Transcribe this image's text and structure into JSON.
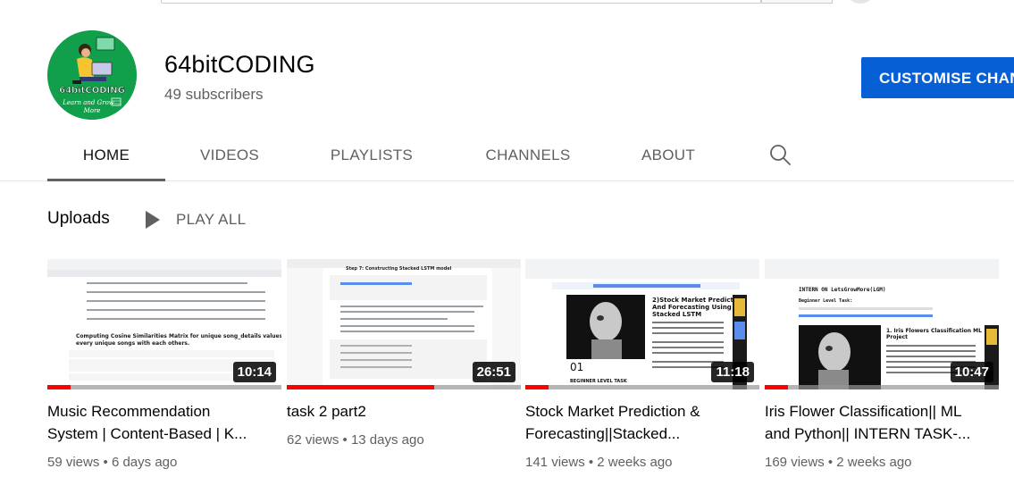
{
  "channel": {
    "name": "64bitCODING",
    "subscribers": "49 subscribers",
    "customise_label": "CUSTOMISE CHANNEL",
    "avatar_text": "64bitCODING",
    "avatar_subtext": "Learn and Grow More",
    "avatar_color": "#119f4b"
  },
  "tabs": [
    {
      "label": "HOME",
      "active": true
    },
    {
      "label": "VIDEOS"
    },
    {
      "label": "PLAYLISTS"
    },
    {
      "label": "CHANNELS"
    },
    {
      "label": "ABOUT"
    }
  ],
  "tab_search_icon": "search-icon",
  "section": {
    "title": "Uploads",
    "play_all": "PLAY ALL"
  },
  "videos": [
    {
      "title_line1": "Music Recommendation",
      "title_line2": "System | Content-Based | K...",
      "views": "59 views",
      "age": "6 days ago",
      "duration": "10:14",
      "watched_fraction": 0.1,
      "thumb_heading": "Computing Cosine Similarities Matrix for unique song_details values / for every unique songs with each others."
    },
    {
      "title_line1": "task 2 part2",
      "title_line2": "",
      "views": "62 views",
      "age": "13 days ago",
      "duration": "26:51",
      "watched_fraction": 0.63,
      "thumb_heading": "Step 7: Constructing Stacked LSTM model"
    },
    {
      "title_line1": "Stock Market Prediction &",
      "title_line2": "Forecasting||Stacked...",
      "views": "141 views",
      "age": "2 weeks ago",
      "duration": "11:18",
      "watched_fraction": 0.1,
      "thumb_heading": "2)Stock Market Prediction And Forecasting Using Stacked LSTM",
      "thumb_caption": "01",
      "thumb_footer": "BEGINNER LEVEL TASK"
    },
    {
      "title_line1": "Iris Flower Classification|| ML",
      "title_line2": "and Python|| INTERN TASK-...",
      "views": "169 views",
      "age": "2 weeks ago",
      "duration": "10:47",
      "watched_fraction": 0.1,
      "thumb_heading": "INTERN ON LetsGrowMore(LGM)",
      "thumb_sub": "Beginner Level Task:",
      "thumb_caption": "1. Iris Flowers Classification ML Project"
    }
  ],
  "colors": {
    "accent": "#065fd4",
    "progress_red": "#ff0000",
    "muted_text": "#606060"
  }
}
